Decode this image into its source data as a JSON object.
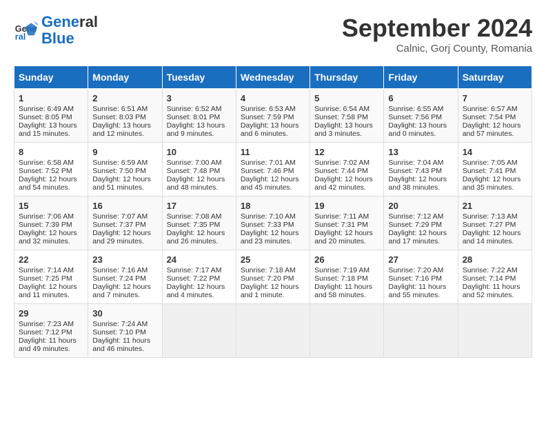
{
  "header": {
    "logo_line1": "General",
    "logo_line2": "Blue",
    "month": "September 2024",
    "location": "Calnic, Gorj County, Romania"
  },
  "days_of_week": [
    "Sunday",
    "Monday",
    "Tuesday",
    "Wednesday",
    "Thursday",
    "Friday",
    "Saturday"
  ],
  "weeks": [
    [
      {
        "day": "1",
        "lines": [
          "Sunrise: 6:49 AM",
          "Sunset: 8:05 PM",
          "Daylight: 13 hours",
          "and 15 minutes."
        ]
      },
      {
        "day": "2",
        "lines": [
          "Sunrise: 6:51 AM",
          "Sunset: 8:03 PM",
          "Daylight: 13 hours",
          "and 12 minutes."
        ]
      },
      {
        "day": "3",
        "lines": [
          "Sunrise: 6:52 AM",
          "Sunset: 8:01 PM",
          "Daylight: 13 hours",
          "and 9 minutes."
        ]
      },
      {
        "day": "4",
        "lines": [
          "Sunrise: 6:53 AM",
          "Sunset: 7:59 PM",
          "Daylight: 13 hours",
          "and 6 minutes."
        ]
      },
      {
        "day": "5",
        "lines": [
          "Sunrise: 6:54 AM",
          "Sunset: 7:58 PM",
          "Daylight: 13 hours",
          "and 3 minutes."
        ]
      },
      {
        "day": "6",
        "lines": [
          "Sunrise: 6:55 AM",
          "Sunset: 7:56 PM",
          "Daylight: 13 hours",
          "and 0 minutes."
        ]
      },
      {
        "day": "7",
        "lines": [
          "Sunrise: 6:57 AM",
          "Sunset: 7:54 PM",
          "Daylight: 12 hours",
          "and 57 minutes."
        ]
      }
    ],
    [
      {
        "day": "8",
        "lines": [
          "Sunrise: 6:58 AM",
          "Sunset: 7:52 PM",
          "Daylight: 12 hours",
          "and 54 minutes."
        ]
      },
      {
        "day": "9",
        "lines": [
          "Sunrise: 6:59 AM",
          "Sunset: 7:50 PM",
          "Daylight: 12 hours",
          "and 51 minutes."
        ]
      },
      {
        "day": "10",
        "lines": [
          "Sunrise: 7:00 AM",
          "Sunset: 7:48 PM",
          "Daylight: 12 hours",
          "and 48 minutes."
        ]
      },
      {
        "day": "11",
        "lines": [
          "Sunrise: 7:01 AM",
          "Sunset: 7:46 PM",
          "Daylight: 12 hours",
          "and 45 minutes."
        ]
      },
      {
        "day": "12",
        "lines": [
          "Sunrise: 7:02 AM",
          "Sunset: 7:44 PM",
          "Daylight: 12 hours",
          "and 42 minutes."
        ]
      },
      {
        "day": "13",
        "lines": [
          "Sunrise: 7:04 AM",
          "Sunset: 7:43 PM",
          "Daylight: 12 hours",
          "and 38 minutes."
        ]
      },
      {
        "day": "14",
        "lines": [
          "Sunrise: 7:05 AM",
          "Sunset: 7:41 PM",
          "Daylight: 12 hours",
          "and 35 minutes."
        ]
      }
    ],
    [
      {
        "day": "15",
        "lines": [
          "Sunrise: 7:06 AM",
          "Sunset: 7:39 PM",
          "Daylight: 12 hours",
          "and 32 minutes."
        ]
      },
      {
        "day": "16",
        "lines": [
          "Sunrise: 7:07 AM",
          "Sunset: 7:37 PM",
          "Daylight: 12 hours",
          "and 29 minutes."
        ]
      },
      {
        "day": "17",
        "lines": [
          "Sunrise: 7:08 AM",
          "Sunset: 7:35 PM",
          "Daylight: 12 hours",
          "and 26 minutes."
        ]
      },
      {
        "day": "18",
        "lines": [
          "Sunrise: 7:10 AM",
          "Sunset: 7:33 PM",
          "Daylight: 12 hours",
          "and 23 minutes."
        ]
      },
      {
        "day": "19",
        "lines": [
          "Sunrise: 7:11 AM",
          "Sunset: 7:31 PM",
          "Daylight: 12 hours",
          "and 20 minutes."
        ]
      },
      {
        "day": "20",
        "lines": [
          "Sunrise: 7:12 AM",
          "Sunset: 7:29 PM",
          "Daylight: 12 hours",
          "and 17 minutes."
        ]
      },
      {
        "day": "21",
        "lines": [
          "Sunrise: 7:13 AM",
          "Sunset: 7:27 PM",
          "Daylight: 12 hours",
          "and 14 minutes."
        ]
      }
    ],
    [
      {
        "day": "22",
        "lines": [
          "Sunrise: 7:14 AM",
          "Sunset: 7:25 PM",
          "Daylight: 12 hours",
          "and 11 minutes."
        ]
      },
      {
        "day": "23",
        "lines": [
          "Sunrise: 7:16 AM",
          "Sunset: 7:24 PM",
          "Daylight: 12 hours",
          "and 7 minutes."
        ]
      },
      {
        "day": "24",
        "lines": [
          "Sunrise: 7:17 AM",
          "Sunset: 7:22 PM",
          "Daylight: 12 hours",
          "and 4 minutes."
        ]
      },
      {
        "day": "25",
        "lines": [
          "Sunrise: 7:18 AM",
          "Sunset: 7:20 PM",
          "Daylight: 12 hours",
          "and 1 minute."
        ]
      },
      {
        "day": "26",
        "lines": [
          "Sunrise: 7:19 AM",
          "Sunset: 7:18 PM",
          "Daylight: 11 hours",
          "and 58 minutes."
        ]
      },
      {
        "day": "27",
        "lines": [
          "Sunrise: 7:20 AM",
          "Sunset: 7:16 PM",
          "Daylight: 11 hours",
          "and 55 minutes."
        ]
      },
      {
        "day": "28",
        "lines": [
          "Sunrise: 7:22 AM",
          "Sunset: 7:14 PM",
          "Daylight: 11 hours",
          "and 52 minutes."
        ]
      }
    ],
    [
      {
        "day": "29",
        "lines": [
          "Sunrise: 7:23 AM",
          "Sunset: 7:12 PM",
          "Daylight: 11 hours",
          "and 49 minutes."
        ]
      },
      {
        "day": "30",
        "lines": [
          "Sunrise: 7:24 AM",
          "Sunset: 7:10 PM",
          "Daylight: 11 hours",
          "and 46 minutes."
        ]
      },
      {
        "day": "",
        "lines": []
      },
      {
        "day": "",
        "lines": []
      },
      {
        "day": "",
        "lines": []
      },
      {
        "day": "",
        "lines": []
      },
      {
        "day": "",
        "lines": []
      }
    ]
  ]
}
